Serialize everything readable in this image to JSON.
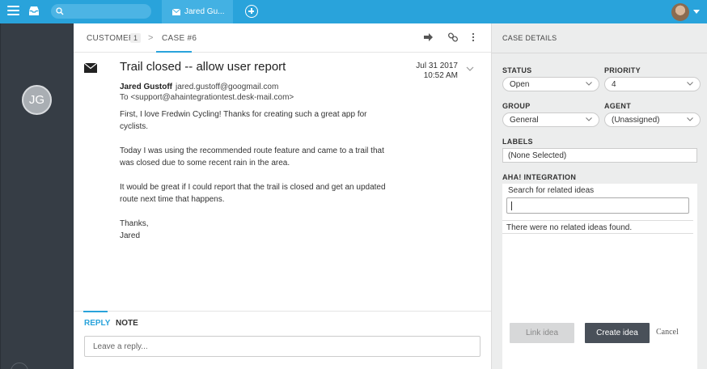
{
  "topbar": {
    "search_placeholder": "",
    "active_tab_label": "Jared Gu...",
    "accent_color": "#29a3db"
  },
  "sidebar": {
    "avatar_initials": "JG"
  },
  "breadcrumb": {
    "customer_label": "CUSTOMER",
    "customer_count": "1",
    "separator": ">",
    "case_label": "CASE #6"
  },
  "message": {
    "subject": "Trail closed -- allow user report",
    "from_name": "Jared Gustoff",
    "from_email": "jared.gustoff@googmail.com",
    "to_line": "To <support@ahaintegrationtest.desk-mail.com>",
    "date": "Jul 31 2017",
    "time": "10:52 AM",
    "paragraphs": [
      "First, I love Fredwin Cycling! Thanks for creating such a great app for cyclists.",
      "Today I was using the recommended route feature and came to a trail that was closed due to some recent rain in the area.",
      "It would be great if I could report that the trail is closed and get an updated route next time that happens.",
      "Thanks,",
      "Jared"
    ]
  },
  "reply": {
    "tab_reply": "REPLY",
    "tab_note": "NOTE",
    "placeholder": "Leave a reply..."
  },
  "case_details": {
    "title": "CASE DETAILS",
    "status_label": "STATUS",
    "status_value": "Open",
    "priority_label": "PRIORITY",
    "priority_value": "4",
    "group_label": "GROUP",
    "group_value": "General",
    "agent_label": "AGENT",
    "agent_value": "(Unassigned)",
    "labels_label": "LABELS",
    "labels_value": "(None Selected)",
    "aha_label": "AHA! INTEGRATION",
    "aha_search_label": "Search for related ideas",
    "aha_empty_text": "There were no related ideas found.",
    "link_idea_label": "Link idea",
    "create_idea_label": "Create idea",
    "cancel_label": "Cancel"
  }
}
